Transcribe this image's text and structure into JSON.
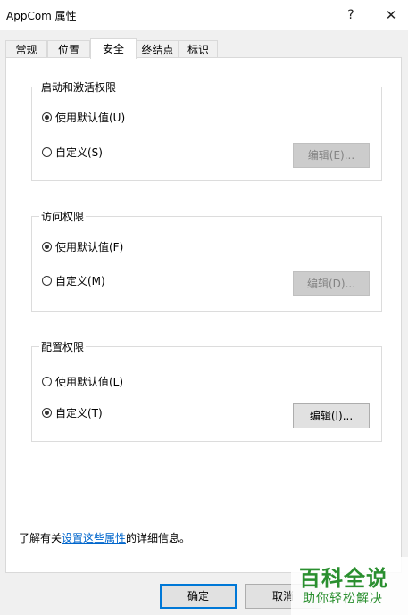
{
  "window": {
    "title": "AppCom 属性",
    "help_glyph": "?",
    "close_glyph": "✕"
  },
  "tabs": [
    {
      "label": "常规",
      "active": false
    },
    {
      "label": "位置",
      "active": false
    },
    {
      "label": "安全",
      "active": true
    },
    {
      "label": "终结点",
      "active": false
    },
    {
      "label": "标识",
      "active": false
    }
  ],
  "groups": {
    "launch": {
      "title": "启动和激活权限",
      "option_default": "使用默认值(U)",
      "option_custom": "自定义(S)",
      "edit_label": "编辑(E)...",
      "selected": "default"
    },
    "access": {
      "title": "访问权限",
      "option_default": "使用默认值(F)",
      "option_custom": "自定义(M)",
      "edit_label": "编辑(D)...",
      "selected": "default"
    },
    "config": {
      "title": "配置权限",
      "option_default": "使用默认值(L)",
      "option_custom": "自定义(T)",
      "edit_label": "编辑(I)...",
      "selected": "custom"
    }
  },
  "info": {
    "prefix": "了解有关",
    "link": "设置这些属性",
    "suffix": "的详细信息。"
  },
  "buttons": {
    "ok": "确定",
    "cancel": "取消"
  },
  "watermark": {
    "main": "百科全说",
    "sub": "助你轻松解决"
  }
}
